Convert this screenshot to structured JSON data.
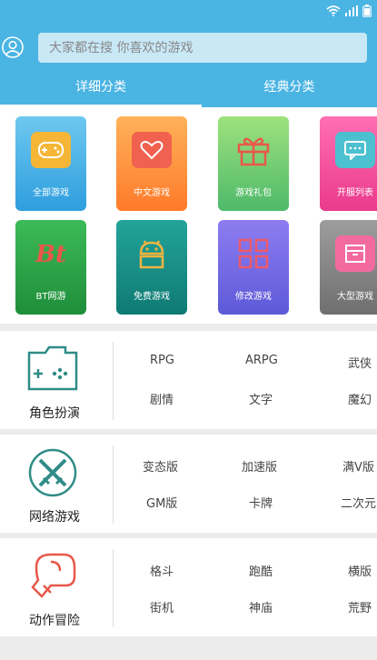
{
  "search": {
    "placeholder": "大家都在搜 你喜欢的游戏"
  },
  "tabs": [
    {
      "label": "详细分类",
      "active": true
    },
    {
      "label": "经典分类",
      "active": false
    }
  ],
  "categories": [
    {
      "label": "全部游戏",
      "icon": "gamepad-icon",
      "from": "#6ec8ef",
      "to": "#2e9ede"
    },
    {
      "label": "中文游戏",
      "icon": "heart-icon",
      "from": "#ffb25a",
      "to": "#ff7a2a"
    },
    {
      "label": "游戏礼包",
      "icon": "gift-icon",
      "from": "#9ee27d",
      "to": "#4eb96a"
    },
    {
      "label": "开服列表",
      "icon": "message-icon",
      "from": "#ff6fb2",
      "to": "#ea3a8c"
    },
    {
      "label": "BT网游",
      "icon": "bt-icon",
      "from": "#3cba58",
      "to": "#1f8e3a"
    },
    {
      "label": "免费游戏",
      "icon": "android-icon",
      "from": "#23a49a",
      "to": "#0f7a73"
    },
    {
      "label": "修改游戏",
      "icon": "grid-icon",
      "from": "#8d7cf1",
      "to": "#5d5ad8"
    },
    {
      "label": "大型游戏",
      "icon": "box-icon",
      "from": "#9d9d9d",
      "to": "#6f6f6f"
    }
  ],
  "sections": [
    {
      "title": "角色扮演",
      "icon": "folder-gamepad-icon",
      "tags": [
        "RPG",
        "ARPG",
        "武侠",
        "剧情",
        "文字",
        "魔幻"
      ]
    },
    {
      "title": "网络游戏",
      "icon": "crossed-swords-icon",
      "tags": [
        "变态版",
        "加速版",
        "满V版",
        "GM版",
        "卡牌",
        "二次元"
      ]
    },
    {
      "title": "动作冒险",
      "icon": "boxing-glove-icon",
      "tags": [
        "格斗",
        "跑酷",
        "横版",
        "街机",
        "神庙",
        "荒野"
      ]
    }
  ]
}
